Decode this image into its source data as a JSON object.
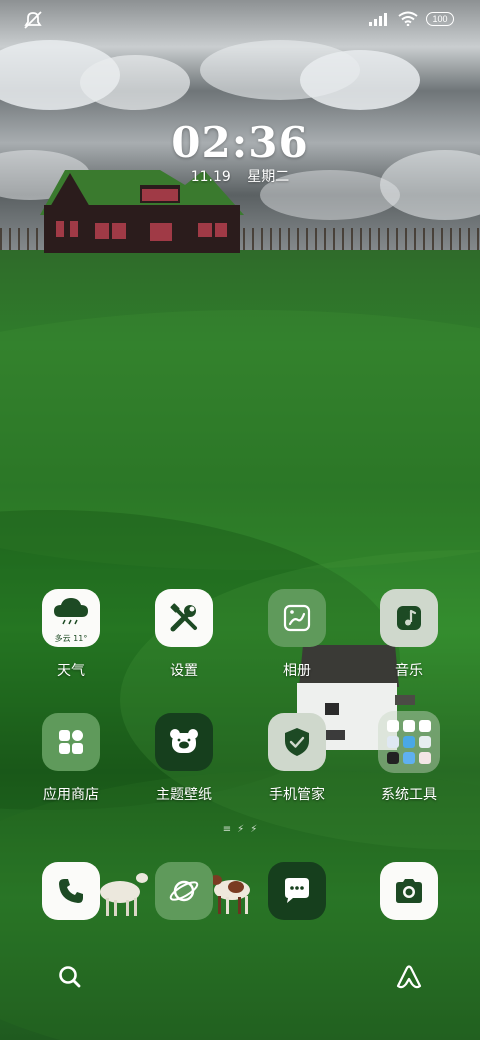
{
  "status_bar": {
    "left_icon": "no-notification-icon",
    "right_icons": [
      "signal-icon",
      "wifi-icon"
    ],
    "battery": "100"
  },
  "clock": {
    "time": "02:36",
    "date": "11.19",
    "weekday": "星期二"
  },
  "apps": {
    "weather": {
      "label": "天气",
      "icon_text": "多云 11°",
      "icon": "cloud-icon"
    },
    "settings": {
      "label": "设置",
      "icon": "tools-icon"
    },
    "gallery": {
      "label": "相册",
      "icon": "photo-icon"
    },
    "music": {
      "label": "音乐",
      "icon": "music-note-icon"
    },
    "app_store": {
      "label": "应用商店",
      "icon": "grid-icon"
    },
    "themes": {
      "label": "主题壁纸",
      "icon": "bear-icon"
    },
    "security": {
      "label": "手机管家",
      "icon": "shield-check-icon"
    },
    "tools_folder": {
      "label": "系统工具",
      "icon": "folder-icon"
    }
  },
  "dock": {
    "phone": {
      "icon": "phone-icon"
    },
    "browser": {
      "icon": "planet-icon"
    },
    "messages": {
      "icon": "chat-icon"
    },
    "camera": {
      "icon": "camera-icon"
    },
    "search": {
      "icon": "search-icon"
    },
    "assistant": {
      "icon": "assistant-icon"
    }
  },
  "colors": {
    "icon_white": "#fbfbf9",
    "icon_mid_green": "#5f9a5b",
    "icon_dark_green": "#163f1d",
    "icon_pale": "#cfd8cc"
  }
}
